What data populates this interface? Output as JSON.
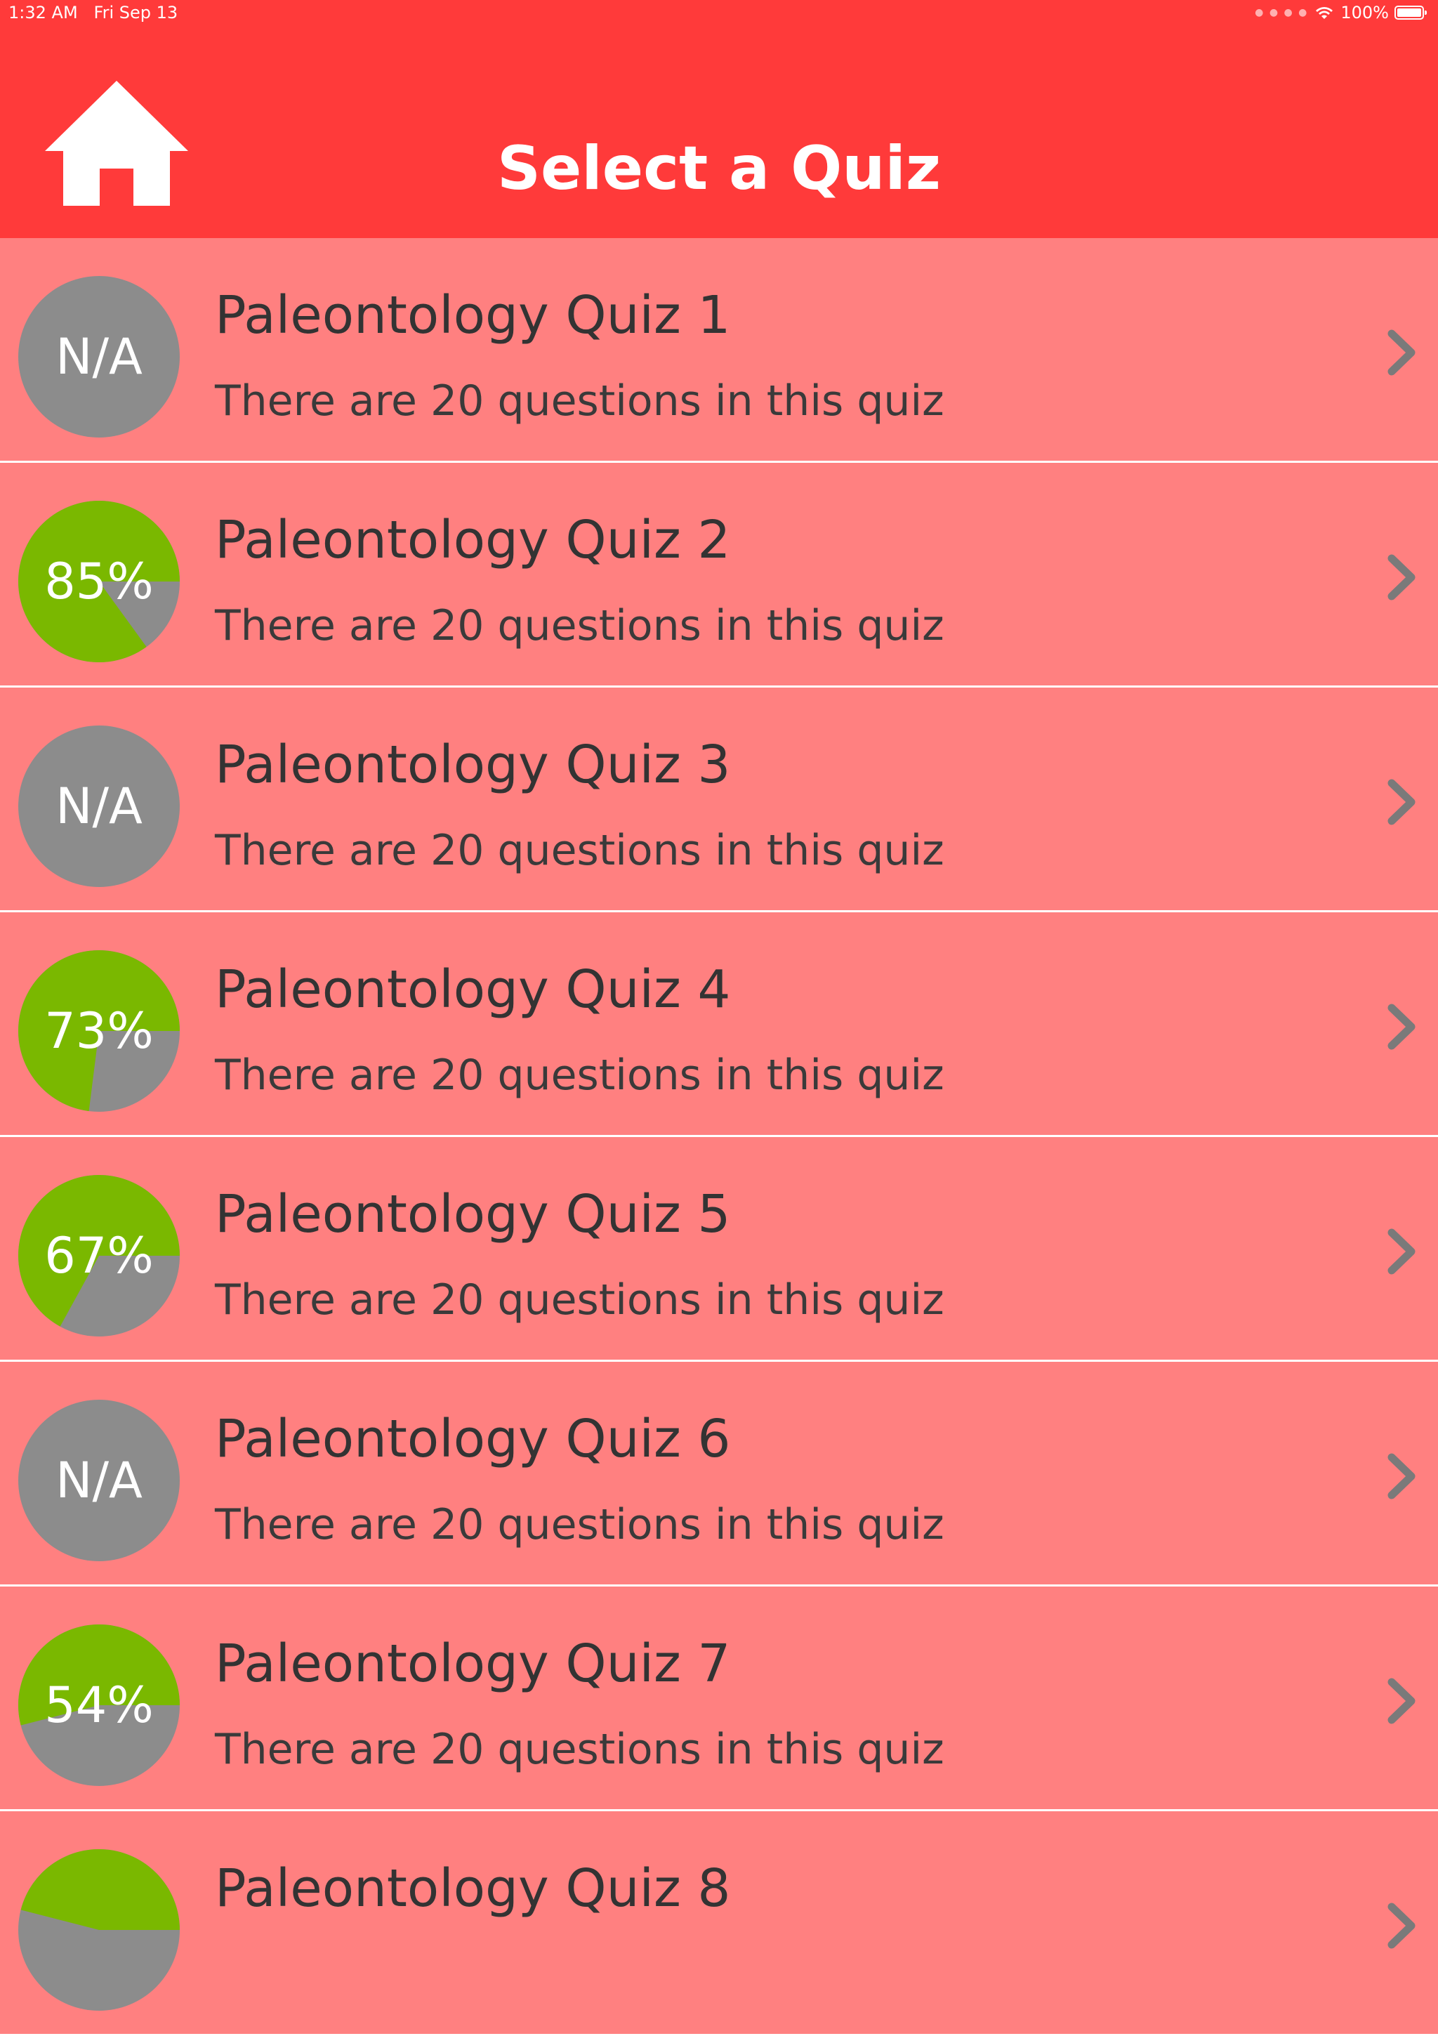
{
  "status_bar": {
    "time": "1:32 AM   Fri Sep 13",
    "battery": "100%"
  },
  "header": {
    "title": "Select a Quiz",
    "home_icon": "home-icon"
  },
  "colors": {
    "header": "#ff3a3a",
    "row_background": "#ff8080",
    "score_fill": "#7ab800",
    "score_remainder": "#8c8c8c",
    "chevron": "#7a7a7a"
  },
  "quizzes": [
    {
      "title": "Paleontology Quiz 1",
      "subtitle": "There are 20 questions in this quiz",
      "score_label": "N/A",
      "score_fraction": null
    },
    {
      "title": "Paleontology Quiz 2",
      "subtitle": "There are 20 questions in this quiz",
      "score_label": "85%",
      "score_fraction": 0.85
    },
    {
      "title": "Paleontology Quiz 3",
      "subtitle": "There are 20 questions in this quiz",
      "score_label": "N/A",
      "score_fraction": null
    },
    {
      "title": "Paleontology Quiz 4",
      "subtitle": "There are 20 questions in this quiz",
      "score_label": "73%",
      "score_fraction": 0.73
    },
    {
      "title": "Paleontology Quiz 5",
      "subtitle": "There are 20 questions in this quiz",
      "score_label": "67%",
      "score_fraction": 0.67
    },
    {
      "title": "Paleontology Quiz 6",
      "subtitle": "There are 20 questions in this quiz",
      "score_label": "N/A",
      "score_fraction": null
    },
    {
      "title": "Paleontology Quiz 7",
      "subtitle": "There are 20 questions in this quiz",
      "score_label": "54%",
      "score_fraction": 0.54
    },
    {
      "title": "Paleontology Quiz 8",
      "subtitle": "",
      "score_label": "",
      "score_fraction": 0.46
    }
  ]
}
